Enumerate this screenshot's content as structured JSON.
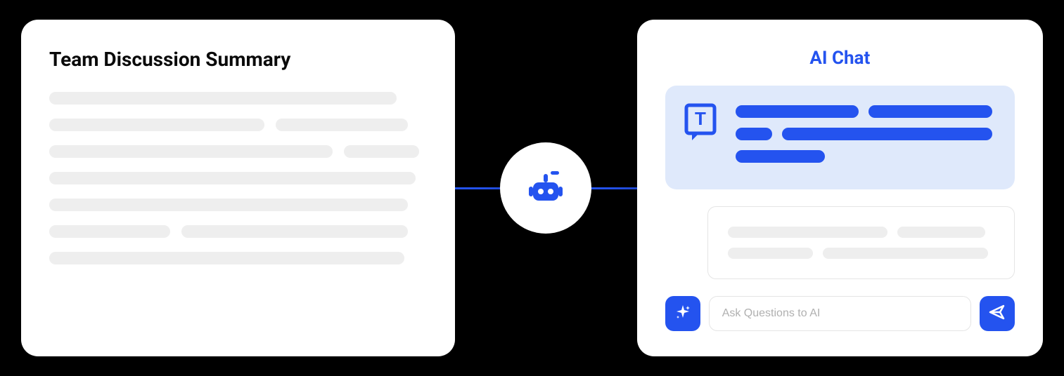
{
  "summary": {
    "title": "Team Discussion Summary"
  },
  "chat": {
    "title": "AI Chat",
    "input_placeholder": "Ask Questions to AI"
  },
  "icons": {
    "robot": "robot-icon",
    "text_avatar": "text-avatar-icon",
    "sparkle": "sparkle-icon",
    "send": "send-icon"
  },
  "colors": {
    "primary": "#2453ef",
    "ai_bubble_bg": "#dfe9fb",
    "skeleton": "#eeeeee"
  }
}
